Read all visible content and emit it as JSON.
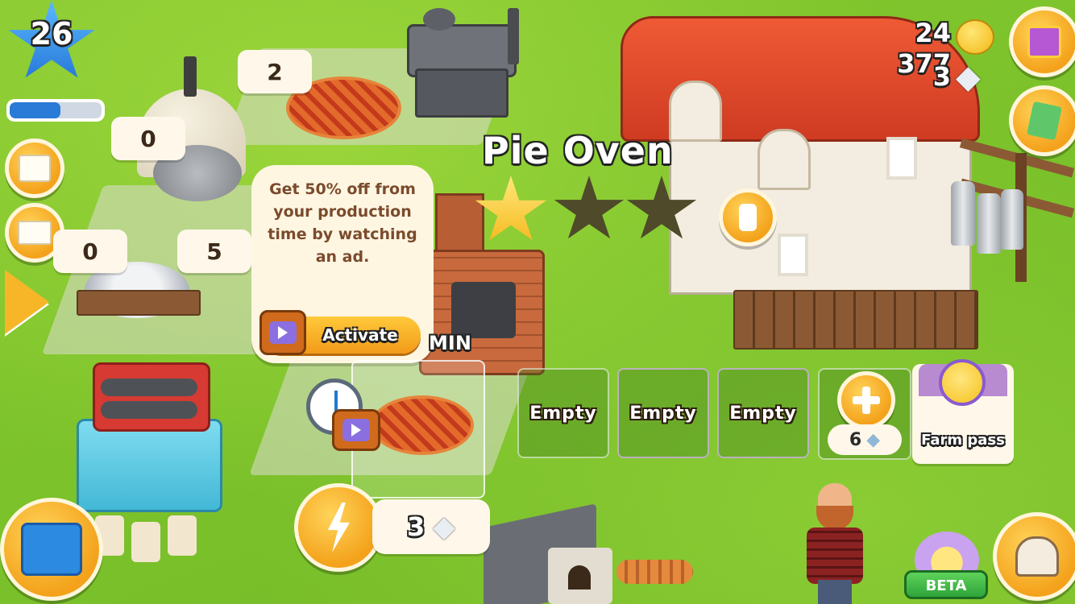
{
  "player": {
    "level": "26",
    "xp_progress": 0.55
  },
  "resources": {
    "coins": "24 377",
    "diamonds": "3"
  },
  "building": {
    "name": "Pie Oven",
    "stars_earned": 1,
    "stars_total": 3
  },
  "pie_counts": {
    "top": "2",
    "left_upper": "0",
    "left_lower": "0",
    "middle": "5"
  },
  "tooltip": {
    "text": "Get 50% off from your production time by watching an ad.",
    "activate_label": "Activate"
  },
  "timer_fragment": "MIN",
  "queue": {
    "slots": [
      "Empty",
      "Empty",
      "Empty"
    ],
    "add_slot_cost": "6"
  },
  "farm_pass": {
    "label": "Farm pass"
  },
  "speedup": {
    "cost": "3"
  },
  "beta": {
    "label": "BETA"
  },
  "colors": {
    "coin": "#f7c21c",
    "button_orange": "#f4a21b",
    "grass": "#7fc42c",
    "roof_red": "#e0452b"
  }
}
